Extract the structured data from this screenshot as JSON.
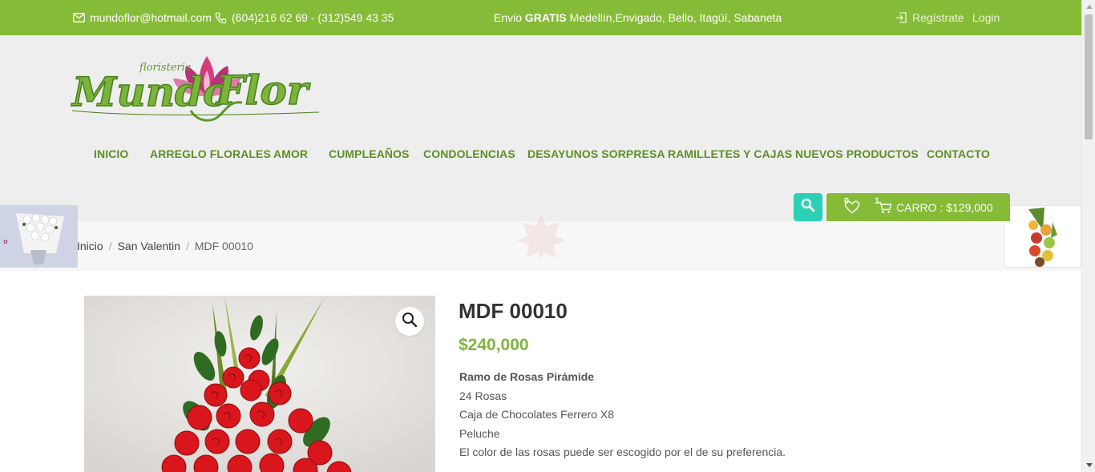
{
  "topbar": {
    "email": "mundoflor@hotmail.com",
    "phone": "(604)216 62 69 - (312)549 43 35",
    "shipping_prefix": "Envio ",
    "shipping_bold": "GRATIS",
    "shipping_suffix": " Medellín,Envigado, Bello, Itagüí, Sabaneta",
    "register": "Regístrate",
    "login": "Login"
  },
  "logo": {
    "script_text": "Mundo Flor",
    "small_text": "floristeria",
    "alt": "Mundo Flor"
  },
  "nav": {
    "items": [
      {
        "label": "INICIO"
      },
      {
        "label": "ARREGLO FLORALES"
      },
      {
        "label": "AMOR"
      },
      {
        "label": "CUMPLEAÑOS"
      },
      {
        "label": "CONDOLENCIAS"
      },
      {
        "label": "DESAYUNOS SORPRESA"
      },
      {
        "label": "RAMILLETES Y CAJAS"
      },
      {
        "label": "NUEVOS PRODUCTOS"
      },
      {
        "label": "CONTACTO"
      }
    ]
  },
  "cart": {
    "wishlist_count": "0",
    "cart_count": "1",
    "label": "CARRO : $129,000"
  },
  "breadcrumb": {
    "items": [
      "Inicio",
      "San Valentin"
    ],
    "current": "MDF 00010"
  },
  "product": {
    "title": "MDF 00010",
    "price": "$240,000",
    "description": [
      "Ramo de Rosas Pirámide",
      "24 Rosas",
      "Caja de Chocolates Ferrero X8",
      "Peluche",
      "El color de las rosas puede ser escogido por el de su preferencia."
    ]
  },
  "icons": {
    "email": "envelope-icon",
    "phone": "phone-icon",
    "register": "sign-in-icon",
    "search": "search-icon",
    "wishlist": "heart-icon",
    "cart": "cart-icon",
    "zoom": "magnifier-icon"
  },
  "colors": {
    "brand_green": "#86bb38",
    "nav_green": "#5f8f24",
    "price_green": "#7fb541",
    "search_teal": "#2cd0b6",
    "logo_pink": "#d63b7c"
  }
}
